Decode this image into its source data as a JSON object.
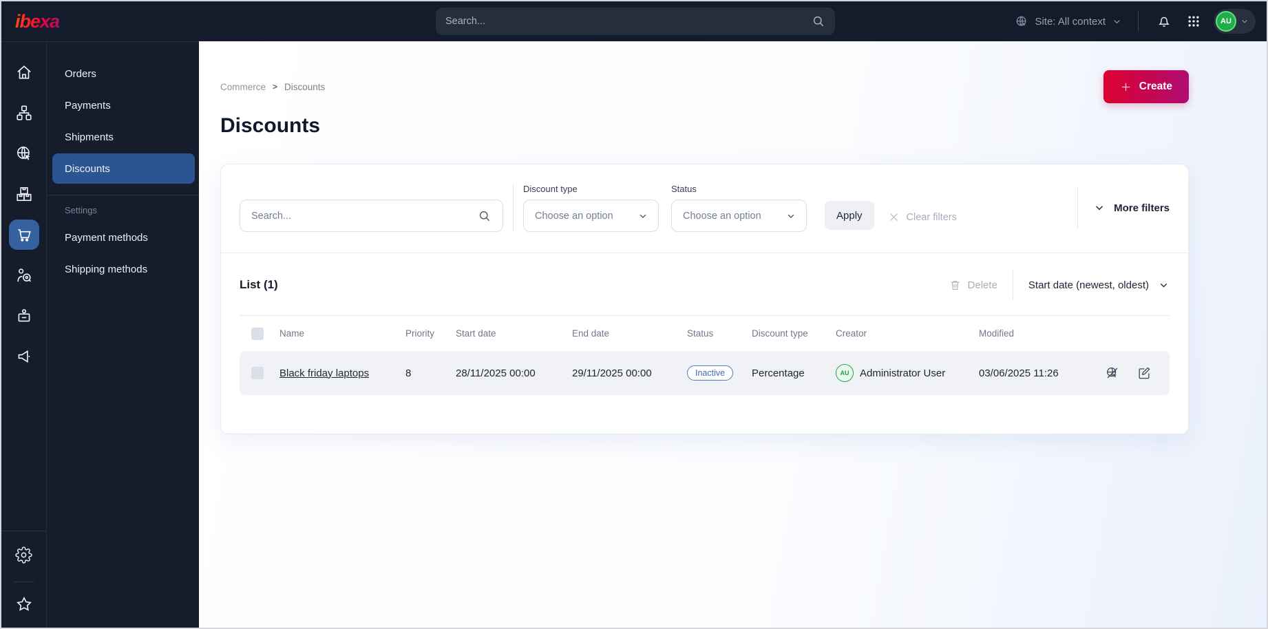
{
  "topbar": {
    "logo": "ibexa",
    "search_placeholder": "Search...",
    "site_context": "Site: All context",
    "avatar_initials": "AU"
  },
  "nav_rail": {
    "items": [
      {
        "icon": "home-icon",
        "active": false
      },
      {
        "icon": "sitemap-icon",
        "active": false
      },
      {
        "icon": "globe-cursor-icon",
        "active": false
      },
      {
        "icon": "product-boxes-icon",
        "active": false
      },
      {
        "icon": "shopping-cart-icon",
        "active": true
      },
      {
        "icon": "customer-target-icon",
        "active": false
      },
      {
        "icon": "user-badge-icon",
        "active": false
      },
      {
        "icon": "megaphone-icon",
        "active": false
      }
    ],
    "bottom_items": [
      {
        "icon": "gear-icon"
      },
      {
        "icon": "star-icon"
      }
    ]
  },
  "menu": {
    "items": [
      "Orders",
      "Payments",
      "Shipments",
      "Discounts"
    ],
    "active_item": "Discounts",
    "section_label": "Settings",
    "settings_items": [
      "Payment methods",
      "Shipping methods"
    ]
  },
  "breadcrumb": {
    "items": [
      "Commerce",
      "Discounts"
    ],
    "separator": ">"
  },
  "page": {
    "title": "Discounts",
    "create_label": "Create"
  },
  "filters": {
    "search_placeholder": "Search...",
    "discount_type_label": "Discount type",
    "discount_type_value": "Choose an option",
    "status_label": "Status",
    "status_value": "Choose an option",
    "apply_label": "Apply",
    "clear_label": "Clear filters",
    "more_label": "More filters"
  },
  "list": {
    "title": "List (1)",
    "delete_label": "Delete",
    "sort_label": "Start date (newest, oldest)"
  },
  "table": {
    "columns": [
      "Name",
      "Priority",
      "Start date",
      "End date",
      "Status",
      "Discount type",
      "Creator",
      "Modified"
    ],
    "rows": [
      {
        "name": "Black friday laptops",
        "priority": "8",
        "start_date": "28/11/2025 00:00",
        "end_date": "29/11/2025 00:00",
        "status": "Inactive",
        "discount_type": "Percentage",
        "creator": "Administrator User",
        "creator_initials": "AU",
        "modified": "03/06/2025 11:26",
        "actions": [
          "deactivate-icon",
          "edit-icon"
        ]
      }
    ]
  },
  "colors": {
    "topbar_bg": "#141c2b",
    "active_blue": "#2b5590",
    "rail_active_blue": "#35619e",
    "accent_gradient_start": "#dc0231",
    "accent_gradient_end": "#b00d72",
    "badge_blue": "#4c7cc0",
    "avatar_green": "#2ea44f",
    "row_bg": "#f1f2f6"
  }
}
